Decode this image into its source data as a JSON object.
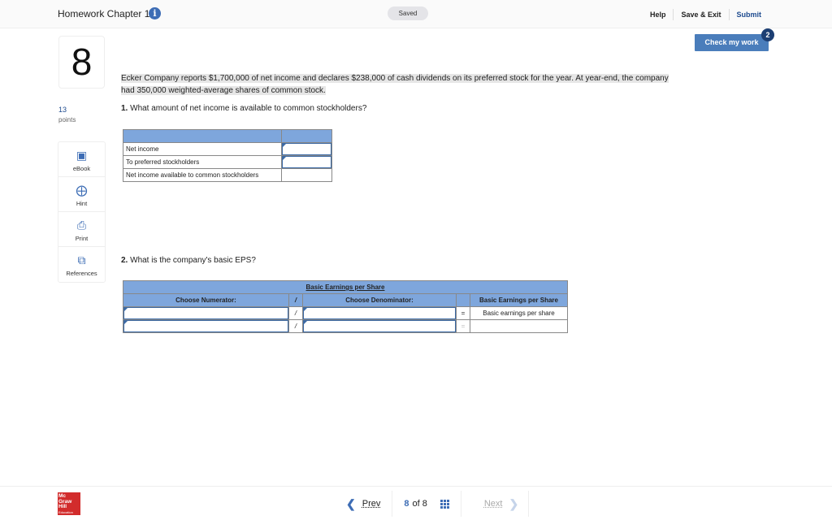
{
  "header": {
    "title": "Homework Chapter 11",
    "info_icon": "info-icon",
    "status": "Saved",
    "links": {
      "help": "Help",
      "save_exit": "Save & Exit",
      "submit": "Submit"
    },
    "check_work": {
      "label": "Check my work",
      "badge": "2"
    }
  },
  "question": {
    "number": "8",
    "points": "13",
    "points_label": "points"
  },
  "tools": [
    {
      "label": "eBook",
      "icon": "book-icon"
    },
    {
      "label": "Hint",
      "icon": "lifebuoy-icon"
    },
    {
      "label": "Print",
      "icon": "printer-icon"
    },
    {
      "label": "References",
      "icon": "copy-icon"
    }
  ],
  "problem_text": "Ecker Company reports $1,700,000 of net income and declares $238,000 of cash dividends on its preferred stock for the year. At year-end, the company had 350,000 weighted-average shares of common stock.",
  "part1": {
    "num": "1.",
    "text": "What amount of net income is available to common stockholders?",
    "rows": [
      {
        "label": "Net income",
        "value": ""
      },
      {
        "label": "To preferred stockholders",
        "value": ""
      },
      {
        "label": "Net income available to common stockholders",
        "value": ""
      }
    ]
  },
  "part2": {
    "num": "2.",
    "text": "What is the company's basic EPS?",
    "table_title": "Basic Earnings per Share",
    "col_numerator": "Choose Numerator:",
    "col_slash": "/",
    "col_denominator": "Choose Denominator:",
    "col_result": "Basic Earnings per Share",
    "rows": [
      {
        "numerator": "",
        "slash": "/",
        "denominator": "",
        "eq": "=",
        "result": "Basic earnings per share"
      },
      {
        "numerator": "",
        "slash": "/",
        "denominator": "",
        "eq": "=",
        "result": ""
      }
    ]
  },
  "footer": {
    "logo_lines": [
      "Mc",
      "Graw",
      "Hill",
      "Education"
    ],
    "prev": "Prev",
    "current": "8",
    "of_label": "of 8",
    "next": "Next"
  }
}
